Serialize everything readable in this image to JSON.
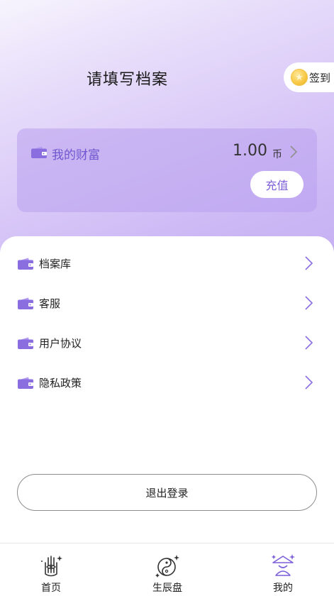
{
  "header": {
    "title": "请填写档案",
    "checkin_label": "签到"
  },
  "wealth": {
    "title": "我的财富",
    "amount": "1.00",
    "unit": "币",
    "recharge_label": "充值"
  },
  "menu": {
    "items": [
      {
        "label": "档案库",
        "icon": "wallet-icon"
      },
      {
        "label": "客服",
        "icon": "wallet-icon"
      },
      {
        "label": "用户协议",
        "icon": "wallet-icon"
      },
      {
        "label": "隐私政策",
        "icon": "wallet-icon"
      }
    ]
  },
  "logout_label": "退出登录",
  "tabbar": {
    "items": [
      {
        "label": "首页",
        "icon": "palm-eye-icon"
      },
      {
        "label": "生辰盘",
        "icon": "yin-yang-icon"
      },
      {
        "label": "我的",
        "icon": "profile-icon",
        "active": true
      }
    ]
  },
  "colors": {
    "accent": "#7c5fd8",
    "wallet": "#8a6ee0",
    "header_gradient_end": "#c6b0f3"
  }
}
